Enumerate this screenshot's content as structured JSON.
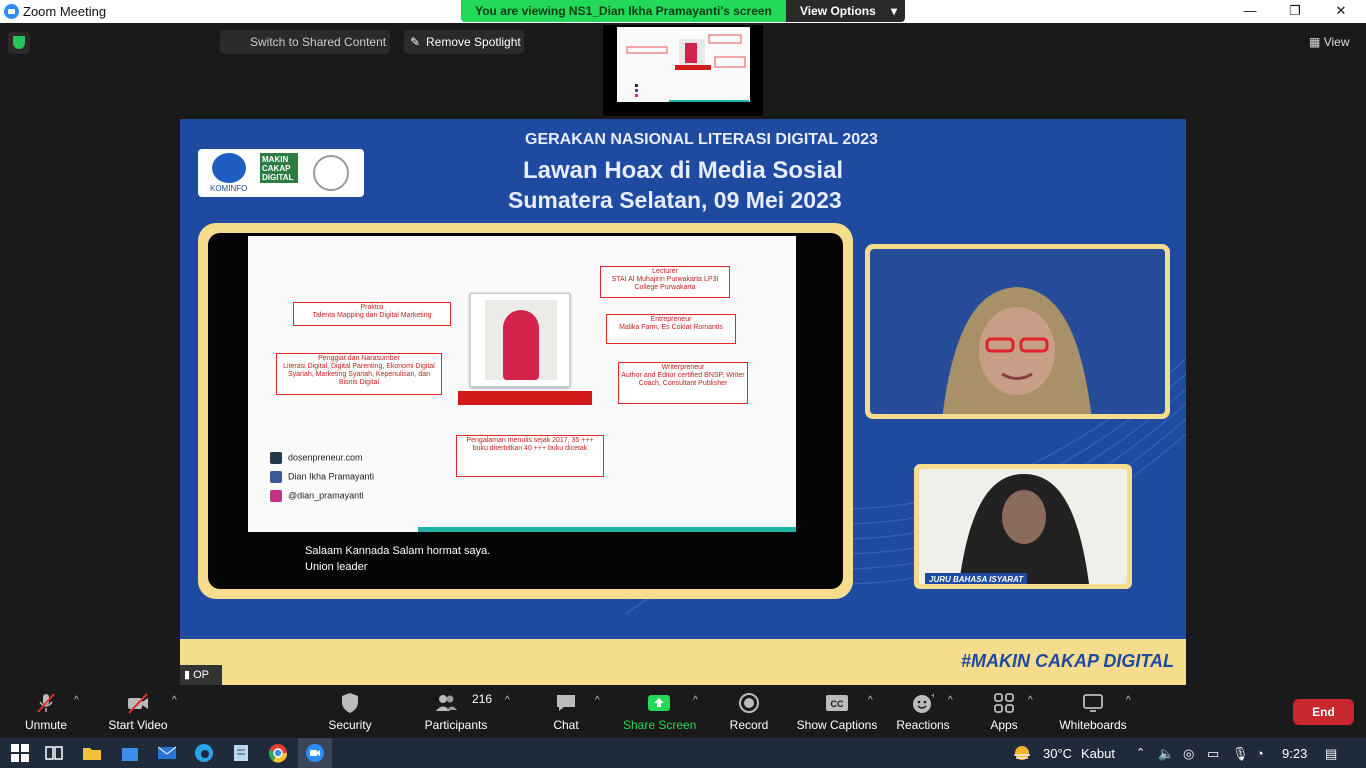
{
  "window": {
    "title": "Zoom Meeting",
    "minimize": "—",
    "restore": "❐",
    "close": "✕"
  },
  "banner": {
    "viewing": "You are viewing NS1_Dian Ikha Pramayanti's screen",
    "options": "View Options"
  },
  "view_button": "View",
  "shared_controls": {
    "switch": "Switch to Shared Content",
    "remove_spotlight": "Remove Spotlight"
  },
  "slide": {
    "event": "GERAKAN NASIONAL LITERASI DIGITAL 2023",
    "title": "Lawan Hoax di Media Sosial",
    "subtitle": "Sumatera Selatan, 09 Mei 2023",
    "hashtag": "#MAKIN CAKAP DIGITAL",
    "logo_kominfo": "KOMINFO",
    "logo_makin": "MAKIN CAKAP DIGITAL",
    "logo_siber": "SIBER KREASI"
  },
  "shared_doc": {
    "praktisi_title": "Praktisi",
    "praktisi_text": "Talenta Mapping dan Digital Marketing",
    "penggiat_title": "Penggiat dan Narasumber",
    "penggiat_text": "Literasi Digital, Digital Parenting, Ekonomi Digital Syariah, Marketing Syariah, Kepenulisan, dan Bisnis Digital",
    "lecturer_title": "Lecturer",
    "lecturer_text": "STAI Al Muhajirin Purwakarta LP3I College Purwakarta",
    "entre_title": "Entrepreneur",
    "entre_text": "Malika Farm, Es Coklat Romantis",
    "writer_title": "Writerpreneur",
    "writer_text": "Author and Editor certified BNSP, Writer Coach, Consultant Publisher",
    "experience_text": "Pengalaman menulis sejak 2017, 35 +++ buku diterbitkan 40 +++ buku dicetak",
    "social": [
      {
        "icon": "web-icon",
        "text": "dosenpreneur.com"
      },
      {
        "icon": "facebook-icon",
        "text": "Dian Ikha Pramayanti"
      },
      {
        "icon": "instagram-icon",
        "text": "@dian_pramayanti"
      }
    ]
  },
  "captions": {
    "line1": "Salaam Kannada Salam hormat saya.",
    "line2": "Union leader"
  },
  "interpreter_tag": "JURU BAHASA ISYARAT",
  "signal": "OP",
  "toolbar": {
    "unmute": "Unmute",
    "start_video": "Start Video",
    "security": "Security",
    "participants": "Participants",
    "participants_count": "216",
    "chat": "Chat",
    "share_screen": "Share Screen",
    "record": "Record",
    "show_captions": "Show Captions",
    "reactions": "Reactions",
    "apps": "Apps",
    "whiteboards": "Whiteboards",
    "end": "End"
  },
  "taskbar": {
    "weather": "30°C",
    "weather_desc": "Kabut",
    "time": "9:23"
  },
  "colors": {
    "share_green": "#23d959",
    "slide_blue": "#1e4ba0",
    "slide_gold": "#f6dc8d",
    "end_red": "#c8282d"
  }
}
